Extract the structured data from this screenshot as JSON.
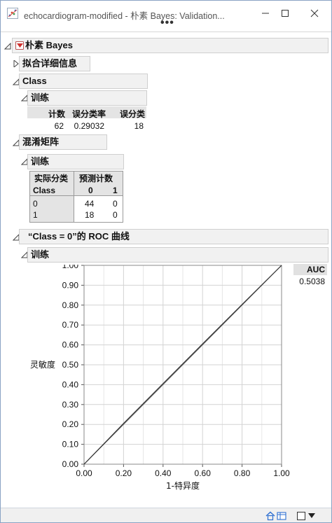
{
  "window": {
    "title": "echocardiogram-modified - 朴素 Bayes: Validation...",
    "menu_dots": "•••"
  },
  "report": {
    "main_title": "朴素 Bayes",
    "fit_details": "拟合详细信息",
    "class_section": "Class",
    "class_training": "训练",
    "class_table": {
      "headers": [
        "计数",
        "误分类率",
        "误分类"
      ],
      "row": [
        "62",
        "0.29032",
        "18"
      ]
    },
    "confusion_section": "混淆矩阵",
    "confusion_training": "训练",
    "confusion": {
      "actual_header": "实际分类",
      "predicted_header": "预测计数",
      "class_label": "Class",
      "col_labels": [
        "0",
        "1"
      ],
      "rows": [
        {
          "label": "0",
          "values": [
            "44",
            "0"
          ]
        },
        {
          "label": "1",
          "values": [
            "18",
            "0"
          ]
        }
      ]
    },
    "roc_section": "“Class = 0”的 ROC 曲线",
    "roc_training": "训练",
    "auc_header": "AUC",
    "auc_value": "0.5038"
  },
  "chart_data": {
    "type": "line",
    "xlabel": "1-特异度",
    "ylabel": "灵敏度",
    "xlim": [
      0,
      1
    ],
    "ylim": [
      0,
      1
    ],
    "x_ticks": [
      "0.00",
      "0.20",
      "0.40",
      "0.60",
      "0.80",
      "1.00"
    ],
    "y_ticks": [
      "0.00",
      "0.10",
      "0.20",
      "0.30",
      "0.40",
      "0.50",
      "0.60",
      "0.70",
      "0.80",
      "0.90",
      "1.00"
    ],
    "grid": true,
    "series": [
      {
        "x": [
          0,
          0.02,
          0.2,
          0.4,
          0.6,
          0.8,
          1.0
        ],
        "y": [
          0,
          0.02,
          0.205,
          0.405,
          0.605,
          0.803,
          1.0
        ]
      }
    ],
    "diagonal_reference": true
  },
  "colors": {
    "accent_red": "#c0392b",
    "header_gray": "#f1f1f1",
    "line": "#333333",
    "grid": "#d3d3d3"
  }
}
